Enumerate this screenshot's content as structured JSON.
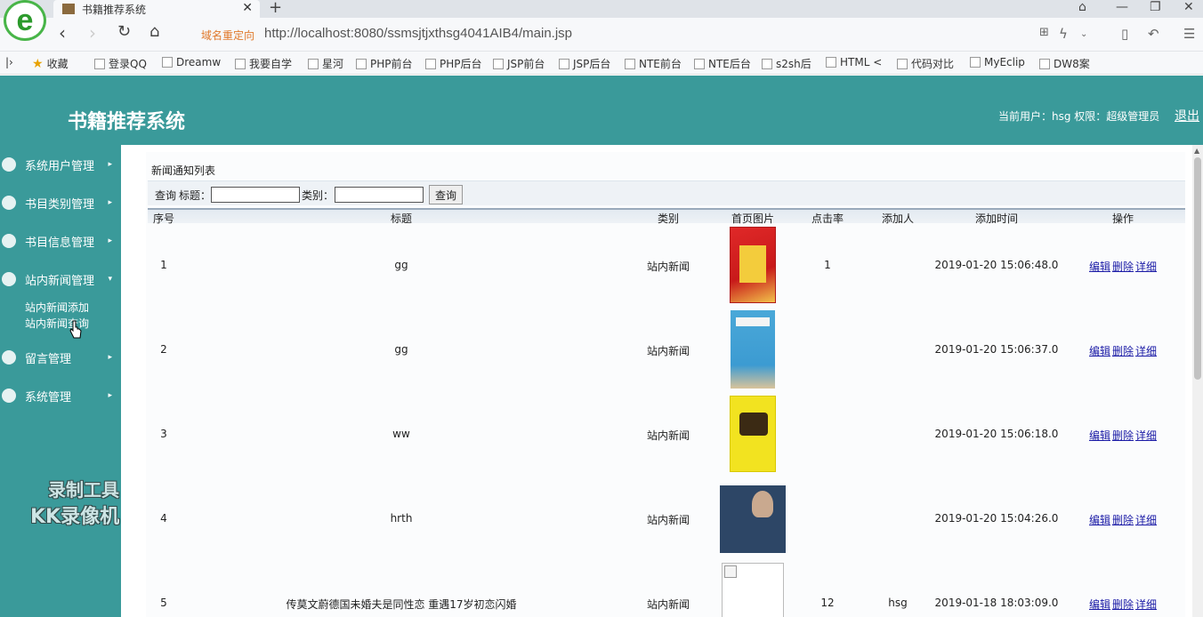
{
  "browser": {
    "tab_title": "书籍推荐系统",
    "redirect_label": "域名重定向",
    "url": "http://localhost:8080/ssmsjtjxthsg4041AIB4/main.jsp",
    "bookmarks": [
      "收藏",
      "登录QQ",
      "Dreamw",
      "我要自学",
      "星河",
      "PHP前台",
      "PHP后台",
      "JSP前台",
      "JSP后台",
      "NTE前台",
      "NTE后台",
      "s2sh后",
      "HTML <",
      "代码对比",
      "MyEclip",
      "DW8案"
    ]
  },
  "header": {
    "app_title": "书籍推荐系统",
    "user_info": "当前用户：hsg 权限：超级管理员",
    "logout": "退出"
  },
  "sidebar": {
    "items": [
      {
        "label": "系统用户管理",
        "icon": "user-circle-icon"
      },
      {
        "label": "书目类别管理",
        "icon": "user-gear-icon"
      },
      {
        "label": "书目信息管理",
        "icon": "book-info-icon"
      },
      {
        "label": "站内新闻管理",
        "icon": "news-icon",
        "expanded": true
      },
      {
        "label": "留言管理",
        "icon": "message-icon"
      },
      {
        "label": "系统管理",
        "icon": "chart-icon"
      }
    ],
    "submenu": [
      "站内新闻添加",
      "站内新闻查询"
    ],
    "watermark": [
      "录制工具",
      "KK录像机"
    ]
  },
  "main": {
    "panel_title": "新闻通知列表",
    "search": {
      "query_label": "查询",
      "title_label": "标题：",
      "category_label": "类别：",
      "title_value": "",
      "category_value": "",
      "button_label": "查询"
    },
    "columns": [
      "序号",
      "标题",
      "类别",
      "首页图片",
      "点击率",
      "添加人",
      "添加时间",
      "操作"
    ],
    "rows": [
      {
        "no": "1",
        "title": "gg",
        "category": "站内新闻",
        "clicks": "1",
        "adder": "",
        "time": "2019-01-20 15:06:48.0"
      },
      {
        "no": "2",
        "title": "gg",
        "category": "站内新闻",
        "clicks": "",
        "adder": "",
        "time": "2019-01-20 15:06:37.0"
      },
      {
        "no": "3",
        "title": "ww",
        "category": "站内新闻",
        "clicks": "",
        "adder": "",
        "time": "2019-01-20 15:06:18.0"
      },
      {
        "no": "4",
        "title": "hrth",
        "category": "站内新闻",
        "clicks": "",
        "adder": "",
        "time": "2019-01-20 15:04:26.0"
      },
      {
        "no": "5",
        "title": "传莫文蔚德国未婚夫是同性恋 重遇17岁初恋闪婚",
        "category": "站内新闻",
        "clicks": "12",
        "adder": "hsg",
        "time": "2019-01-18 18:03:09.0"
      }
    ],
    "ops": {
      "edit": "编辑",
      "delete": "删除",
      "detail": "详细"
    }
  }
}
